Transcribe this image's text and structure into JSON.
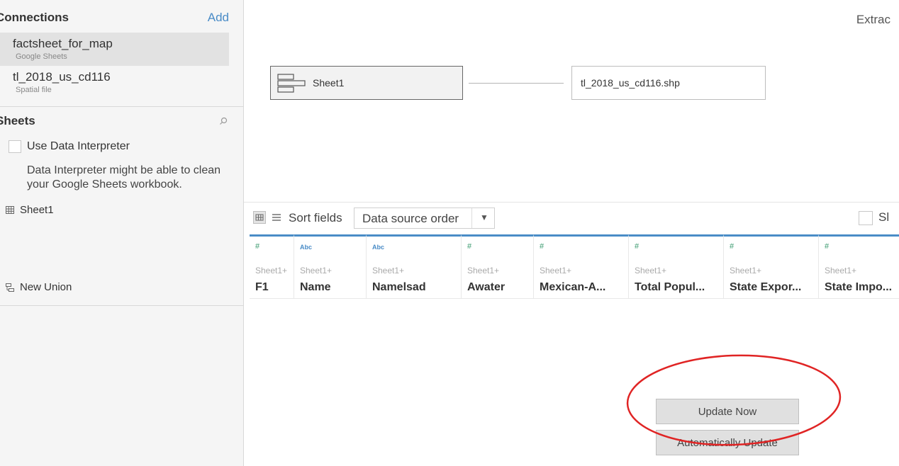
{
  "sidebar": {
    "connections": {
      "title": "Connections",
      "add_label": "Add",
      "items": [
        {
          "name": "factsheet_for_map",
          "type": "Google Sheets"
        },
        {
          "name": "tl_2018_us_cd116",
          "type": "Spatial file"
        }
      ]
    },
    "sheets": {
      "title": "Sheets",
      "search_icon": "search-icon",
      "interpreter_label": "Use Data Interpreter",
      "interpreter_note": "Data Interpreter might be able to clean your Google Sheets workbook.",
      "items": [
        {
          "name": "Sheet1",
          "icon": "table-icon"
        }
      ],
      "new_union_label": "New Union"
    }
  },
  "canvas": {
    "tables": [
      {
        "name": "Sheet1",
        "icon": "join-table-icon"
      },
      {
        "name": "tl_2018_us_cd116.shp"
      }
    ]
  },
  "header": {
    "extract_label": "Extrac"
  },
  "grid_toolbar": {
    "sort_label": "Sort fields",
    "sort_value": "Data source order",
    "right_check_label": "Sl"
  },
  "grid": {
    "columns": [
      {
        "type": "#",
        "source": "Sheet1+",
        "name": "F1"
      },
      {
        "type": "Abc",
        "source": "Sheet1+",
        "name": "Name"
      },
      {
        "type": "Abc",
        "source": "Sheet1+",
        "name": "Namelsad"
      },
      {
        "type": "#",
        "source": "Sheet1+",
        "name": "Awater"
      },
      {
        "type": "#",
        "source": "Sheet1+",
        "name": "Mexican-A..."
      },
      {
        "type": "#",
        "source": "Sheet1+",
        "name": "Total Popul..."
      },
      {
        "type": "#",
        "source": "Sheet1+",
        "name": "State Expor..."
      },
      {
        "type": "#",
        "source": "Sheet1+",
        "name": "State Impo..."
      }
    ]
  },
  "actions": {
    "update_now": "Update Now",
    "auto_update": "Automatically Update"
  },
  "colors": {
    "accent": "#4a8cc7",
    "number_icon": "#3a9a6e",
    "highlight_circle": "#e02424"
  }
}
